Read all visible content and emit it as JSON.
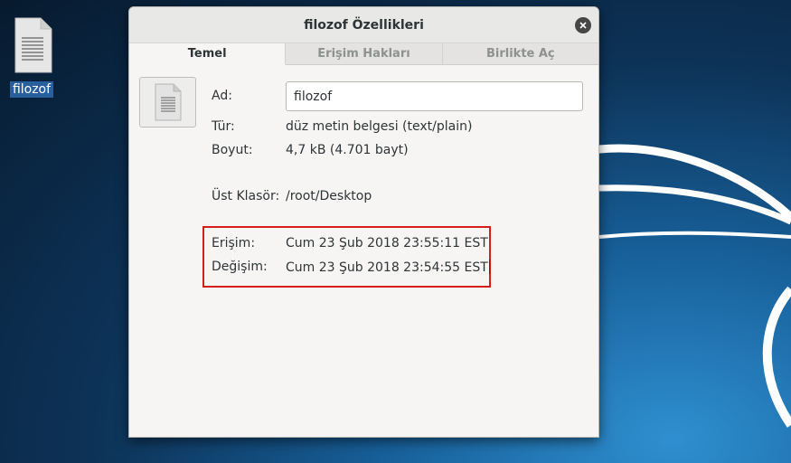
{
  "desktop": {
    "icon_label": "filozof"
  },
  "window": {
    "title": "filozof Özellikleri",
    "close_icon": "close-icon"
  },
  "tabs": [
    {
      "label": "Temel",
      "active": true
    },
    {
      "label": "Erişim Hakları",
      "active": false
    },
    {
      "label": "Birlikte Aç",
      "active": false
    }
  ],
  "properties": {
    "name_label": "Ad:",
    "name_value": "filozof",
    "type_label": "Tür:",
    "type_value": "düz metin belgesi (text/plain)",
    "size_label": "Boyut:",
    "size_value": "4,7 kB (4.701 bayt)",
    "parent_label": "Üst Klasör:",
    "parent_value": "/root/Desktop",
    "accessed_label": "Erişim:",
    "accessed_value": "Cum 23 Şub 2018 23:55:11 EST",
    "modified_label": "Değişim:",
    "modified_value": "Cum 23 Şub 2018 23:54:55 EST"
  },
  "colors": {
    "highlight_border": "#d61e1e",
    "selection": "#2a5f9e"
  }
}
